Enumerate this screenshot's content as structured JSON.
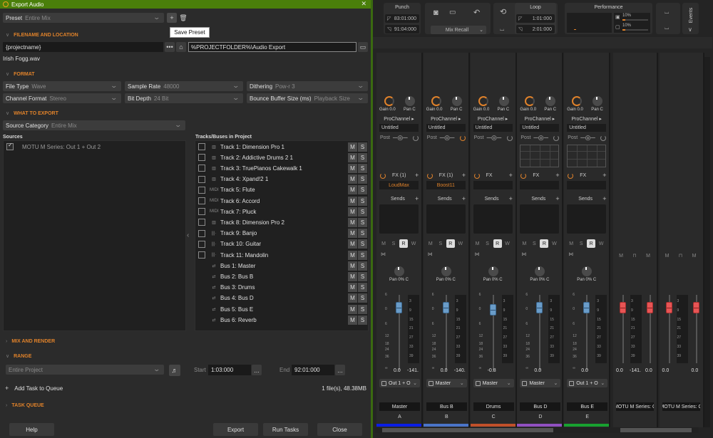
{
  "dialog": {
    "title": "Export Audio",
    "close_icon": "close-icon",
    "preset": {
      "label": "Preset",
      "value": "Entire Mix"
    },
    "save_preset_tooltip": "Save Preset",
    "sections": {
      "filename": "FILENAME AND LOCATION",
      "format": "FORMAT",
      "what_to_export": "WHAT TO EXPORT",
      "mix_and_render": "MIX AND RENDER",
      "range": "RANGE",
      "task_queue": "TASK QUEUE"
    },
    "filename_field": "{projectname}",
    "folder_field": "%PROJECTFOLDER%\\Audio Export",
    "resolved_filename": "Irish Fogg.wav",
    "format": {
      "file_type": {
        "label": "File Type",
        "value": "Wave"
      },
      "sample_rate": {
        "label": "Sample Rate",
        "value": "48000"
      },
      "dithering": {
        "label": "Dithering",
        "value": "Pow-r 3"
      },
      "channel_format": {
        "label": "Channel Format",
        "value": "Stereo"
      },
      "bit_depth": {
        "label": "Bit Depth",
        "value": "24 Bit"
      },
      "bounce_buffer": {
        "label": "Bounce Buffer Size (ms)",
        "value": "Playback Size"
      }
    },
    "source_category": {
      "label": "Source Category",
      "value": "Entire Mix"
    },
    "sources_header": "Sources",
    "sources": [
      {
        "name": "MOTU M Series: Out 1 + Out 2",
        "checked": true
      }
    ],
    "tracks_header": "Tracks/Buses in Project",
    "tracks": [
      {
        "name": "Track 1: Dimension Pro 1",
        "type": "instrument",
        "icon": "▥",
        "checkbox": true
      },
      {
        "name": "Track 2: Addictive Drums 2 1",
        "type": "instrument",
        "icon": "▥",
        "checkbox": true
      },
      {
        "name": "Track 3: TruePianos Cakewalk 1",
        "type": "instrument",
        "icon": "▥",
        "checkbox": true
      },
      {
        "name": "Track 4: Xpand!2 1",
        "type": "instrument",
        "icon": "▥",
        "checkbox": true
      },
      {
        "name": "Track 5: Flute",
        "type": "midi",
        "icon": "MIDI",
        "checkbox": true
      },
      {
        "name": "Track 6: Accord",
        "type": "midi",
        "icon": "MIDI",
        "checkbox": true
      },
      {
        "name": "Track 7: Pluck",
        "type": "midi",
        "icon": "MIDI",
        "checkbox": true
      },
      {
        "name": "Track 8: Dimension Pro 2",
        "type": "instrument",
        "icon": "▥",
        "checkbox": true
      },
      {
        "name": "Track 9: Banjo",
        "type": "audio",
        "icon": "|||·",
        "checkbox": true
      },
      {
        "name": "Track 10: Guitar",
        "type": "audio",
        "icon": "|||·",
        "checkbox": true
      },
      {
        "name": "Track 11: Mandolin",
        "type": "audio",
        "icon": "|||·",
        "checkbox": true
      },
      {
        "name": "Bus 1: Master",
        "type": "bus",
        "icon": "⇄",
        "checkbox": false
      },
      {
        "name": "Bus 2: Bus B",
        "type": "bus",
        "icon": "⇄",
        "checkbox": false
      },
      {
        "name": "Bus 3: Drums",
        "type": "bus",
        "icon": "⇄",
        "checkbox": false
      },
      {
        "name": "Bus 4: Bus D",
        "type": "bus",
        "icon": "⇄",
        "checkbox": false
      },
      {
        "name": "Bus 5: Bus E",
        "type": "bus",
        "icon": "⇄",
        "checkbox": false
      },
      {
        "name": "Bus 6: Reverb",
        "type": "bus",
        "icon": "⇄",
        "checkbox": false
      }
    ],
    "mute_label": "M",
    "solo_label": "S",
    "range": {
      "mode": "Entire Project",
      "start_label": "Start",
      "start_value": "1:03:000",
      "end_label": "End",
      "end_value": "92:01:000",
      "more": "..."
    },
    "add_task": "Add Task to Queue",
    "file_summary": "1 file(s), 48.38MB",
    "buttons": {
      "help": "Help",
      "export": "Export",
      "run_tasks": "Run Tasks",
      "close": "Close"
    }
  },
  "toolbar": {
    "punch": {
      "title": "Punch",
      "in": "83:01:000",
      "out": "91:04:000"
    },
    "mix_recall": "Mix Recall",
    "loop": {
      "title": "Loop",
      "start": "1:01:000",
      "end": "2:01:000"
    },
    "performance": {
      "title": "Performance",
      "cpu": "10%",
      "disk": "10%",
      "cpu_fraction": 0.1,
      "disk_fraction": 0.1
    },
    "events_tab": "Events"
  },
  "mixer": {
    "gain_label": "Gain 0.0",
    "pan_label": "Pan C",
    "prochannel_label": "ProChannel",
    "prochannel_preset": "Untitled",
    "post_label": "Post",
    "sends_label": "Sends",
    "pan_bottom": "Pan 0% C",
    "msrw": [
      "M",
      "S",
      "R",
      "W"
    ],
    "strips": [
      {
        "fx_label": "FX (1)",
        "fx_plugin": "LoudMax",
        "fader": "0.0",
        "peak": "-141.",
        "output": "Out 1 + O",
        "name": "Master",
        "letter": "A",
        "color": "#0a1ee6",
        "prochannel_on": false,
        "eq_graph": false
      },
      {
        "fx_label": "FX (1)",
        "fx_plugin": "Boost11",
        "fader": "0.0",
        "peak": "-140.",
        "output": "Master",
        "name": "Bus B",
        "letter": "B",
        "color": "#4a74c8",
        "prochannel_on": true,
        "eq_graph": false
      },
      {
        "fx_label": "FX",
        "fx_plugin": "",
        "fader": "-0.8",
        "peak": "",
        "output": "Master",
        "name": "Drums",
        "letter": "C",
        "color": "#c0502a",
        "prochannel_on": false,
        "eq_graph": false
      },
      {
        "fx_label": "FX",
        "fx_plugin": "",
        "fader": "0.0",
        "peak": "",
        "output": "Master",
        "name": "Bus D",
        "letter": "D",
        "color": "#9050c0",
        "prochannel_on": false,
        "eq_graph": true
      },
      {
        "fx_label": "FX",
        "fx_plugin": "",
        "fader": "0.0",
        "peak": "",
        "output": "Out 1 + O",
        "name": "Bus E",
        "letter": "E",
        "color": "#18a030",
        "prochannel_on": false,
        "eq_graph": true
      }
    ],
    "hw_outputs": [
      {
        "name": "MOTU M Series: C",
        "left": "0.0",
        "peak": "-141.",
        "right": "0.0"
      },
      {
        "name": "MOTU M Series: C",
        "left": "0.0",
        "peak": "",
        "right": "0.0"
      }
    ],
    "fader_scale": [
      "6",
      "0",
      "6",
      "12",
      "18",
      "24",
      "36",
      "∞"
    ],
    "meter_scale": [
      "3",
      "9",
      "15",
      "21",
      "27",
      "33",
      "39"
    ]
  }
}
